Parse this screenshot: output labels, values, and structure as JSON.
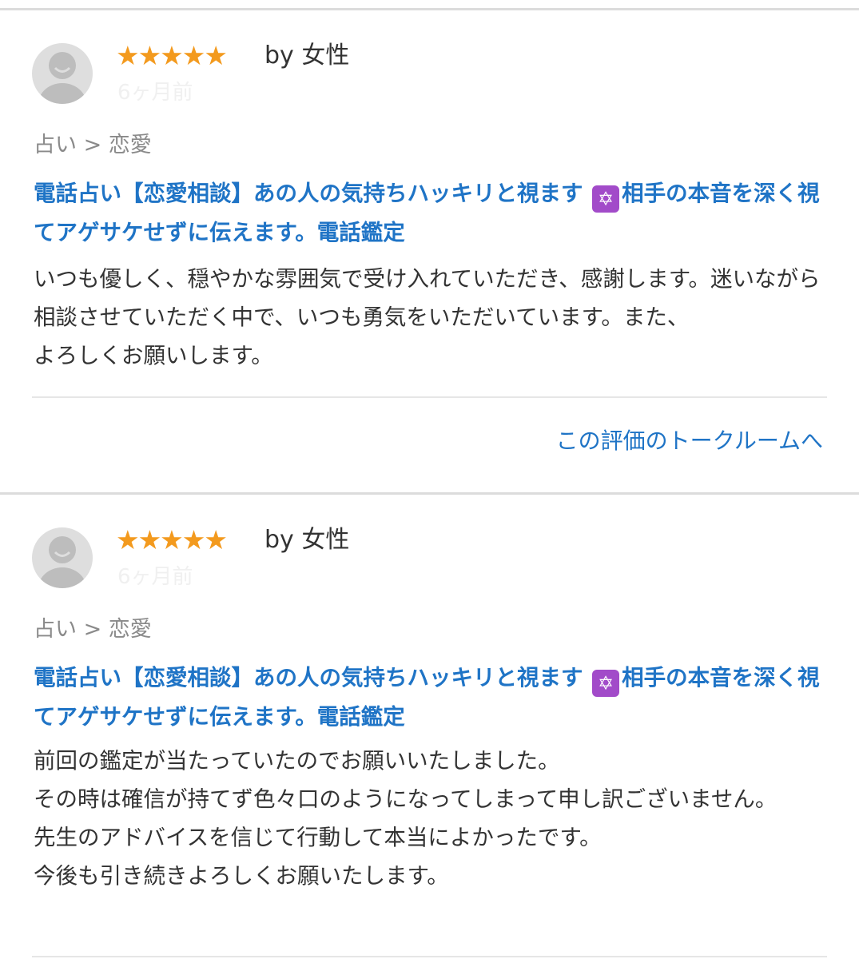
{
  "colors": {
    "link": "#1f74c6",
    "star": "#f39a1e",
    "emoji_bg": "#a24bc9"
  },
  "reviews": [
    {
      "stars": "★★★★★",
      "reviewer": "by 女性",
      "time": "6ヶ月前",
      "category": "占い > 恋愛",
      "title_part1": "電話占い【恋愛相談】あの人の気持ちハッキリと視ます ",
      "title_emoji": "✡",
      "title_part2": "相手の本音を深く視てアゲサケせずに伝えます。電話鑑定",
      "body": "いつも優しく、穏やかな雰囲気で受け入れていただき、感謝します。迷いながら相談させていただく中で、いつも勇気をいただいています。また、\nよろしくお願いします。",
      "talkroom_link": "この評価のトークルームへ"
    },
    {
      "stars": "★★★★★",
      "reviewer": "by 女性",
      "time": "6ヶ月前",
      "category": "占い > 恋愛",
      "title_part1": "電話占い【恋愛相談】あの人の気持ちハッキリと視ます ",
      "title_emoji": "✡",
      "title_part2": "相手の本音を深く視てアゲサケせずに伝えます。電話鑑定",
      "body": "前回の鑑定が当たっていたのでお願いいたしました。\nその時は確信が持てず色々口のようになってしまって申し訳ございません。\n先生のアドバイスを信じて行動して本当によかったです。\n今後も引き続きよろしくお願いたします。"
    }
  ]
}
